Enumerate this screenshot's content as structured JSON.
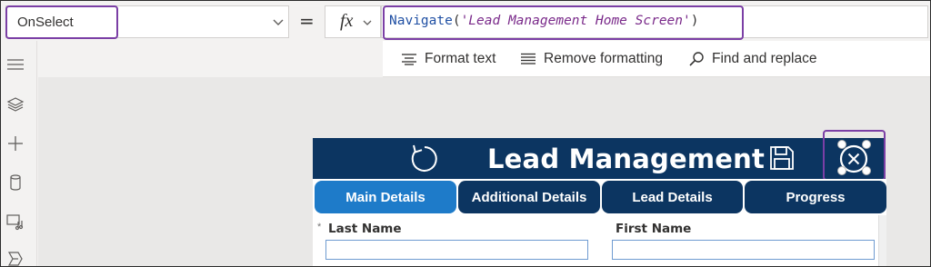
{
  "formula_bar": {
    "property": "OnSelect",
    "equals": "=",
    "fx_label": "fx",
    "formula_function": "Navigate",
    "formula_open": "(",
    "formula_argument": "'Lead Management Home Screen'",
    "formula_close": ")"
  },
  "format_toolbar": {
    "format_text": "Format text",
    "remove_formatting": "Remove formatting",
    "find_replace": "Find and replace"
  },
  "left_rail": {
    "icons": [
      "hamburger-icon",
      "layers-icon",
      "plus-icon",
      "database-icon",
      "media-icon",
      "tools-icon"
    ]
  },
  "app": {
    "title": "Lead Management",
    "header_color": "#0c3561",
    "tabs": [
      {
        "label": "Main Details",
        "active": true
      },
      {
        "label": "Additional Details",
        "active": false
      },
      {
        "label": "Lead Details",
        "active": false
      },
      {
        "label": "Progress",
        "active": false
      }
    ],
    "tab_active_color": "#1e7bc9",
    "tab_color": "#0c3561",
    "form": {
      "required_marker": "*",
      "last_name_label": "Last Name",
      "first_name_label": "First Name"
    }
  },
  "colors": {
    "selection": "#7b3fa5",
    "formula_function": "#1f4fa3",
    "formula_string": "#7a2a8a"
  }
}
